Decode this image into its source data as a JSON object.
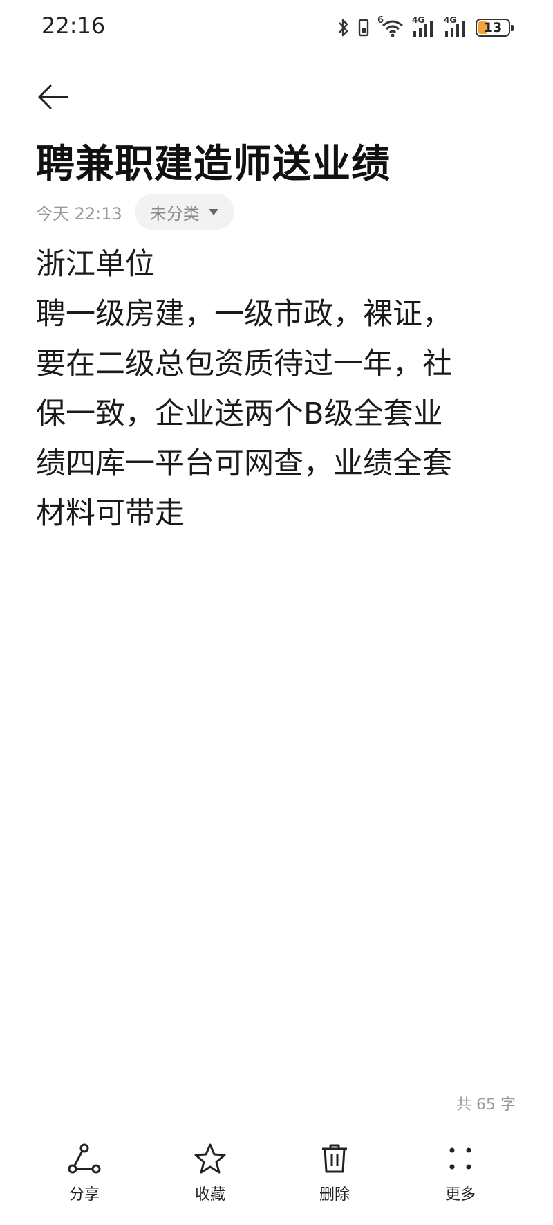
{
  "status_bar": {
    "time": "22:16",
    "icons": [
      "bluetooth-icon",
      "phone-vibrate-icon",
      "wifi-icon",
      "signal-4g-icon",
      "signal-4g-icon"
    ],
    "network_labels": [
      "6",
      "4G",
      "4G"
    ],
    "battery_level": "13",
    "battery_color": "#f3a33a"
  },
  "header": {
    "back_icon": "arrow-left-icon",
    "title": "聘兼职建造师送业绩"
  },
  "meta": {
    "timestamp": "今天 22:13",
    "category": "未分类",
    "category_icon": "caret-down-icon"
  },
  "note": {
    "lines": [
      "浙江单位",
      "聘一级房建，一级市政，裸证，",
      "要在二级总包资质待过一年，社",
      "保一致，企业送两个B级全套业",
      "绩四库一平台可网查，业绩全套",
      "材料可带走"
    ],
    "word_count": "共 65 字"
  },
  "toolbar": {
    "items": [
      {
        "label": "分享",
        "icon": "share-icon"
      },
      {
        "label": "收藏",
        "icon": "star-icon"
      },
      {
        "label": "删除",
        "icon": "trash-icon"
      },
      {
        "label": "更多",
        "icon": "more-dots-icon"
      }
    ]
  }
}
